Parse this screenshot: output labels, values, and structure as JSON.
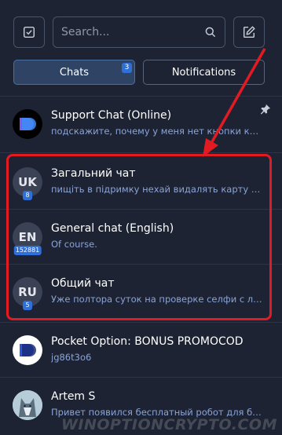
{
  "header": {
    "search_placeholder": "Search...",
    "left_icon": "checkbox-icon",
    "right_icon": "edit-icon"
  },
  "tabs": [
    {
      "label": "Chats",
      "badge": "3",
      "active": true
    },
    {
      "label": "Notifications",
      "active": false
    }
  ],
  "chats": [
    {
      "title": "Support Chat (Online)",
      "preview": "подскажите, почему у меня нет кнопки коп...",
      "avatar": "logo-black",
      "pinned": true
    },
    {
      "title": "Загальний чат",
      "preview": "пищіть в підримку нехай видалять карту та ...",
      "avatar_text": "UK",
      "badge": "8"
    },
    {
      "title": "General chat (English)",
      "preview": "Of course.",
      "avatar_text": "EN",
      "badge": "152881"
    },
    {
      "title": "Общий чат",
      "preview": "Уже полтора суток на проверке селфи с лис...",
      "avatar_text": "RU",
      "badge": "5"
    },
    {
      "title": "Pocket Option: BONUS PROMOCOD",
      "preview": "jg86t3o6",
      "avatar": "logo-white"
    },
    {
      "title": "Artem S",
      "preview": "Привет появился бесплатный робот для би...",
      "avatar": "wolf-photo"
    }
  ],
  "colors": {
    "background": "#1d2332",
    "accent": "#2f6fd6",
    "preview_text": "#8aa4d8",
    "highlight": "#e21b22"
  },
  "watermark": "WINOPTIONCRYPTO.COM"
}
